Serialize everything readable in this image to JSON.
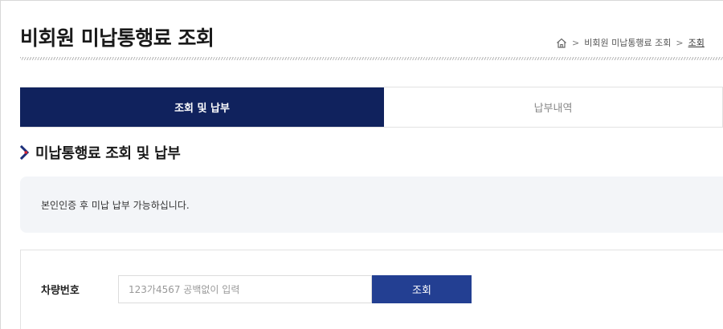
{
  "page": {
    "title": "비회원 미납통행료 조회"
  },
  "breadcrumb": {
    "items": [
      "비회원 미납통행료 조회",
      "조회"
    ]
  },
  "tabs": [
    {
      "label": "조회 및 납부",
      "active": true
    },
    {
      "label": "납부내역",
      "active": false
    }
  ],
  "section": {
    "title": "미납통행료 조회 및 납부"
  },
  "notice": {
    "text": "본인인증 후 미납 납부 가능하십니다."
  },
  "search": {
    "label": "차량번호",
    "placeholder": "123가4567 공백없이 입력",
    "value": "",
    "button_label": "조회"
  },
  "colors": {
    "active_tab": "#10225d",
    "search_button": "#233f92",
    "chevron_primary": "#1c2f7a",
    "chevron_accent": "#e0252f"
  },
  "icons": {
    "home": "home-icon",
    "chevron": "chevron-right-icon"
  }
}
